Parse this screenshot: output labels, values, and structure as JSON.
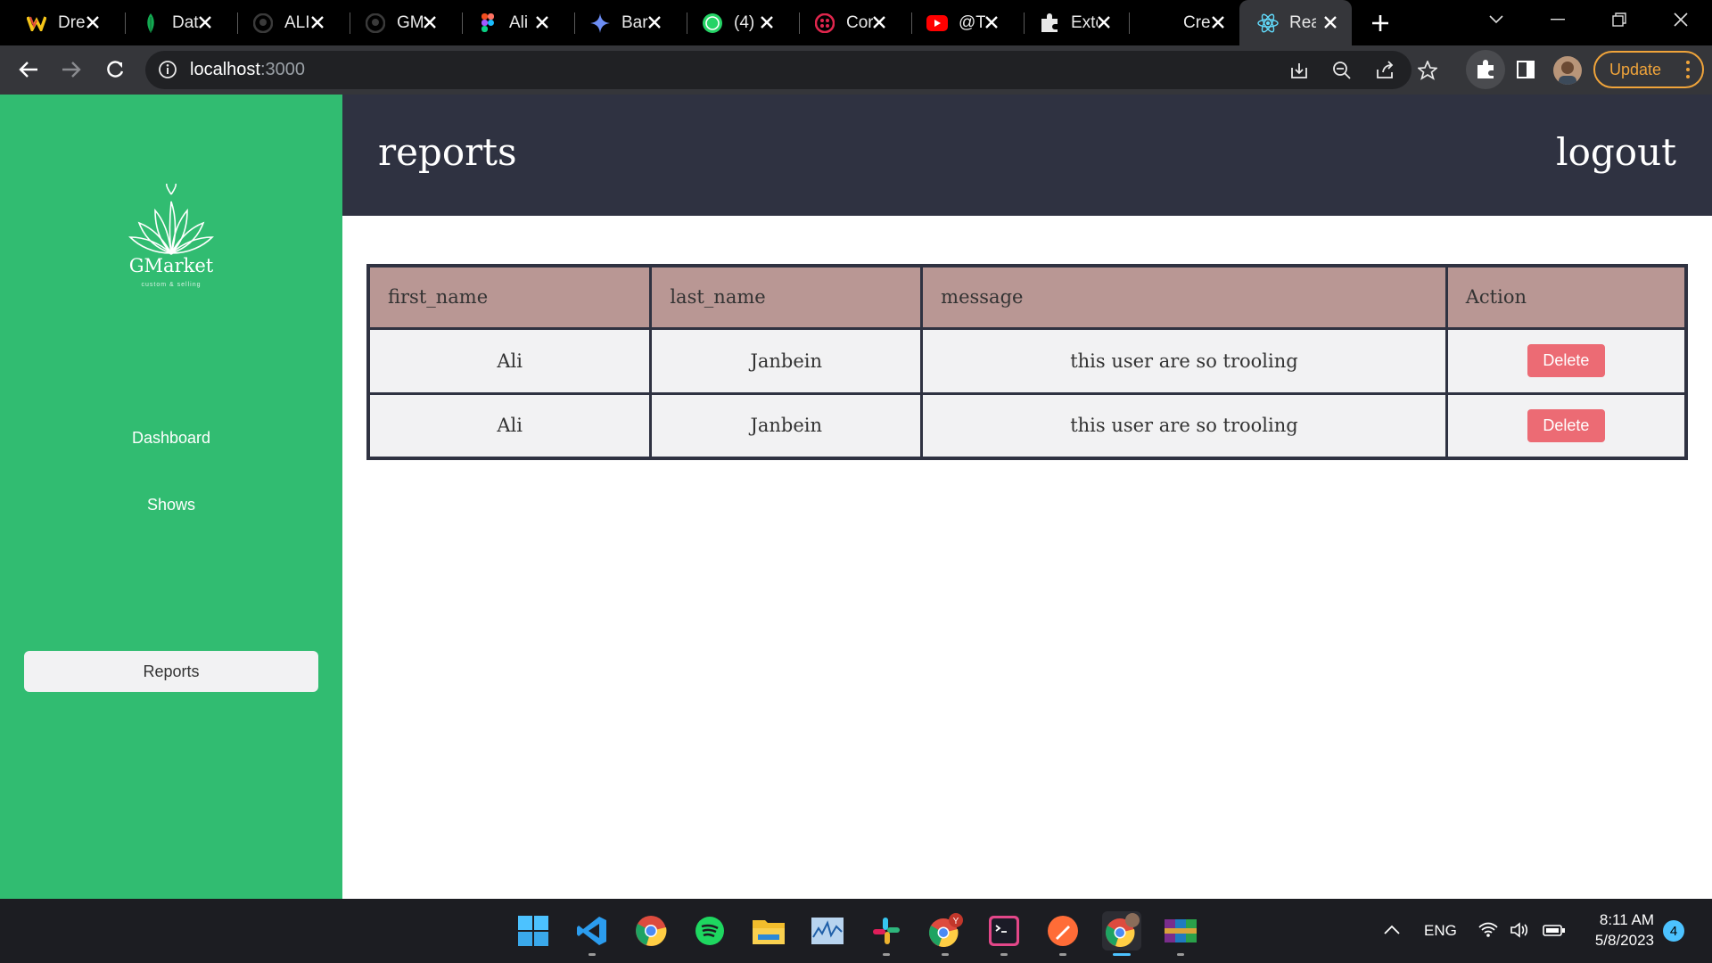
{
  "browser": {
    "tabs": [
      {
        "title": "Dre",
        "icon": "webflow-icon"
      },
      {
        "title": "Dat",
        "icon": "mongodb-icon"
      },
      {
        "title": "ALI",
        "icon": "github-icon"
      },
      {
        "title": "GM",
        "icon": "github-icon"
      },
      {
        "title": "Ali",
        "icon": "figma-icon"
      },
      {
        "title": "Barc",
        "icon": "bard-icon"
      },
      {
        "title": "(4)",
        "icon": "whatsapp-icon"
      },
      {
        "title": "Cor",
        "icon": "sanity-icon"
      },
      {
        "title": "@T",
        "icon": "youtube-icon"
      },
      {
        "title": "Exte",
        "icon": "puzzle-icon"
      },
      {
        "title": "Cre",
        "icon": "blank-icon"
      },
      {
        "title": "Rea",
        "icon": "react-icon",
        "active": true
      }
    ],
    "url_host": "localhost",
    "url_port": ":3000",
    "update_label": "Update"
  },
  "app": {
    "brand": {
      "name": "GMarket",
      "tagline": "custom & selling"
    },
    "nav": [
      {
        "label": "Dashboard",
        "active": false
      },
      {
        "label": "Shows",
        "active": false
      },
      {
        "label": "Reports",
        "active": true
      }
    ],
    "header": {
      "title": "reports",
      "logout_label": "logout"
    },
    "table": {
      "columns": [
        "first_name",
        "last_name",
        "message",
        "Action"
      ],
      "rows": [
        {
          "first_name": "Ali",
          "last_name": "Janbein",
          "message": "this user are so trooling",
          "action": "Delete"
        },
        {
          "first_name": "Ali",
          "last_name": "Janbein",
          "message": "this user are so trooling",
          "action": "Delete"
        }
      ]
    }
  },
  "taskbar": {
    "apps": [
      "windows-start-icon",
      "vscode-icon",
      "chrome-icon",
      "spotify-icon",
      "file-explorer-icon",
      "activity-monitor-icon",
      "slack-icon",
      "chrome-profile-icon",
      "terminal-icon",
      "postman-icon",
      "chrome-active-icon",
      "winrar-icon"
    ],
    "language": "ENG",
    "time": "8:11 AM",
    "date": "5/8/2023",
    "notifications": "4"
  },
  "colors": {
    "sidebar": "#31bc71",
    "header": "#2f3241",
    "table_header": "#b99794",
    "delete_button": "#ec6b74",
    "update_accent": "#f0a43a"
  }
}
